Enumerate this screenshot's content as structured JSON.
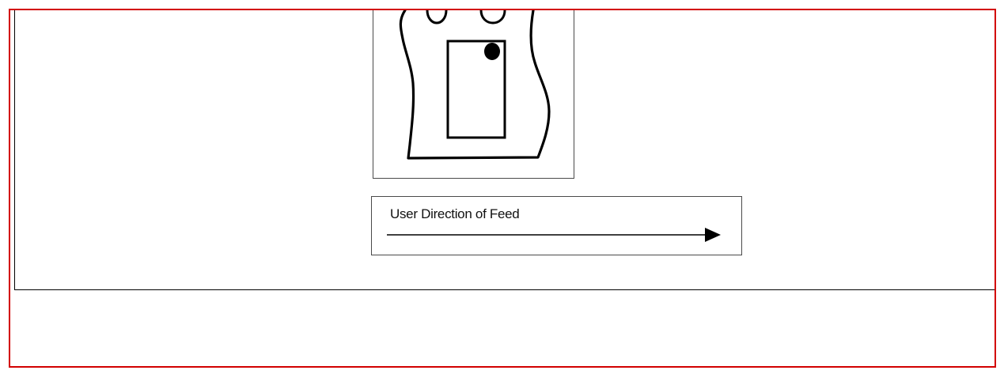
{
  "figure": {
    "caption": "User Direction of Feed",
    "arrow_icon": "right-arrow-icon",
    "figure_icon": "card-outline-icon"
  },
  "colors": {
    "selection_border": "#d20000",
    "line": "#000000",
    "background": "#ffffff"
  }
}
